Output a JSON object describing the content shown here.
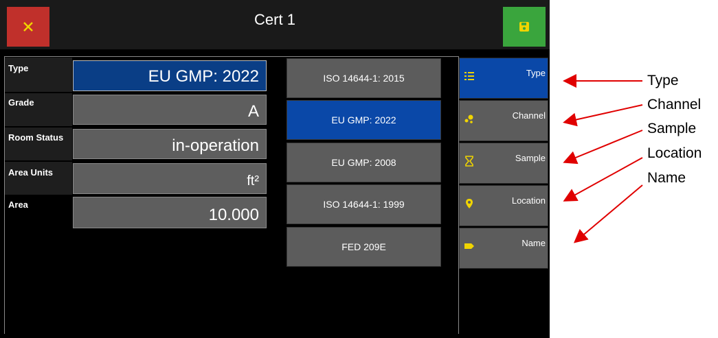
{
  "header": {
    "title": "Cert 1",
    "close_icon": "close-icon",
    "save_icon": "save-icon"
  },
  "colors": {
    "close": "#c0302b",
    "save": "#3aa53d",
    "accent": "#0a48a8",
    "icon_yellow": "#f0d400"
  },
  "fields": [
    {
      "label": "Type",
      "value": "EU GMP: 2022"
    },
    {
      "label": "Grade",
      "value": "A"
    },
    {
      "label": "Room Status",
      "value": "in-operation"
    },
    {
      "label": "Area Units",
      "value": "ft²"
    },
    {
      "label": "Area",
      "value": "10.000"
    }
  ],
  "standards": [
    {
      "label": "ISO 14644-1: 2015",
      "selected": false
    },
    {
      "label": "EU GMP: 2022",
      "selected": true
    },
    {
      "label": "EU GMP: 2008",
      "selected": false
    },
    {
      "label": "ISO 14644-1: 1999",
      "selected": false
    },
    {
      "label": "FED 209E",
      "selected": false
    }
  ],
  "nav": [
    {
      "label": "Type",
      "icon": "list-icon",
      "selected": true
    },
    {
      "label": "Channel",
      "icon": "dots-icon",
      "selected": false
    },
    {
      "label": "Sample",
      "icon": "hourglass-icon",
      "selected": false
    },
    {
      "label": "Location",
      "icon": "location-pin-icon",
      "selected": false
    },
    {
      "label": "Name",
      "icon": "tag-icon",
      "selected": false
    }
  ],
  "annotations": [
    "Type",
    "Channel",
    "Sample",
    "Location",
    "Name"
  ]
}
